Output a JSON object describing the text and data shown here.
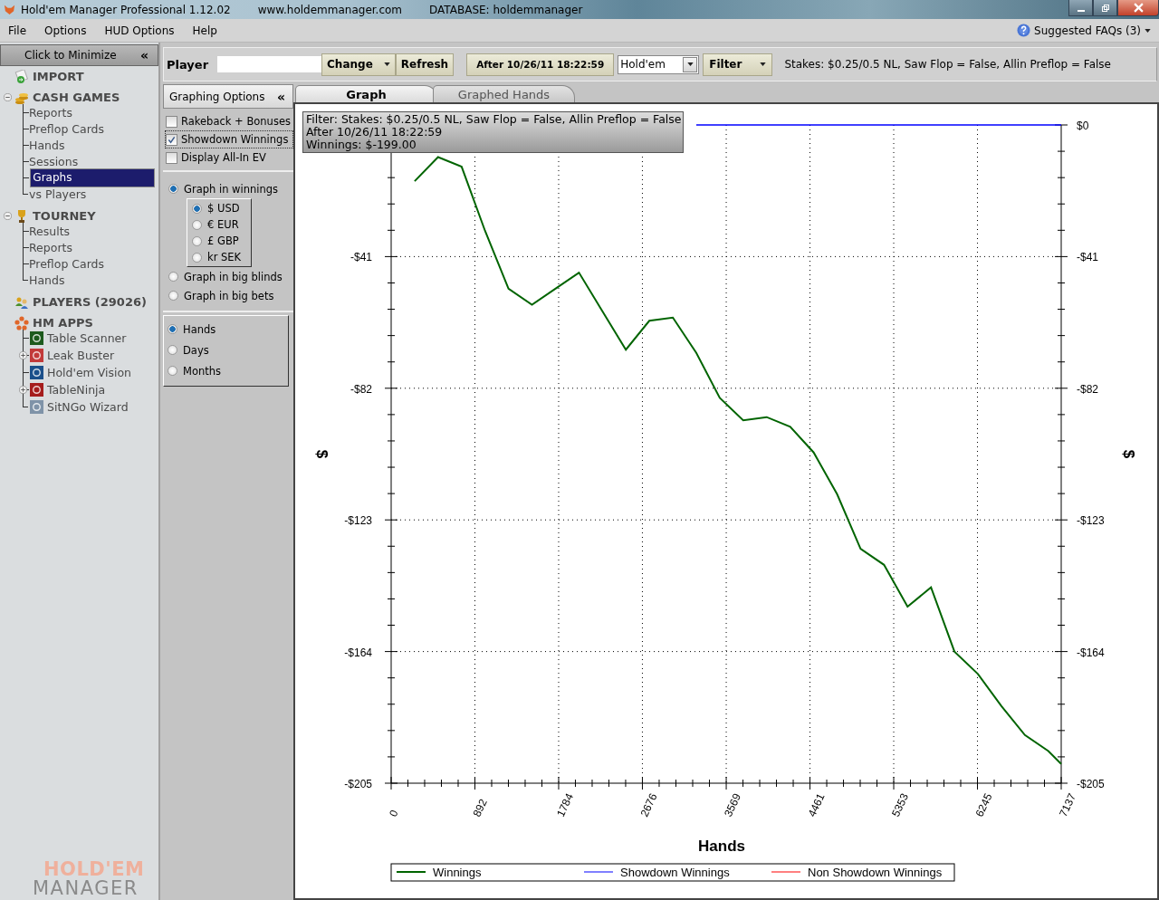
{
  "window": {
    "title": "Hold'em Manager Professional 1.12.02",
    "site": "www.holdemmanager.com",
    "database": "DATABASE: holdemmanager"
  },
  "menu": [
    "File",
    "Options",
    "HUD Options",
    "Help"
  ],
  "faqs": {
    "label": "Suggested FAQs (3)"
  },
  "sidebar": {
    "minimize": {
      "label": "Click to Minimize",
      "glyph": "«"
    },
    "sections": [
      {
        "label": "IMPORT",
        "selected": false
      },
      {
        "label": "CASH GAMES",
        "selected": false,
        "expanded": true,
        "children": [
          {
            "label": "Reports",
            "selected": false
          },
          {
            "label": "Preflop Cards",
            "selected": false
          },
          {
            "label": "Hands",
            "selected": false
          },
          {
            "label": "Sessions",
            "selected": false
          },
          {
            "label": "Graphs",
            "selected": true
          },
          {
            "label": "vs Players",
            "selected": false
          }
        ]
      },
      {
        "label": "TOURNEY",
        "selected": false,
        "expanded": true,
        "children": [
          {
            "label": "Results",
            "selected": false
          },
          {
            "label": "Reports",
            "selected": false
          },
          {
            "label": "Preflop Cards",
            "selected": false
          },
          {
            "label": "Hands",
            "selected": false
          }
        ]
      },
      {
        "label": "PLAYERS (29026)",
        "selected": false
      },
      {
        "label": "HM APPS",
        "selected": false,
        "children": [
          {
            "label": "Table Scanner",
            "selected": false
          },
          {
            "label": "Leak Buster",
            "selected": false,
            "expanded": false
          },
          {
            "label": "Hold'em Vision",
            "selected": false
          },
          {
            "label": "TableNinja",
            "selected": false,
            "expanded": false
          },
          {
            "label": "SitNGo Wizard",
            "selected": false
          }
        ]
      }
    ],
    "logo": [
      "HOLD'EM",
      "MANAGER"
    ]
  },
  "toolbar": {
    "player_label": "Player",
    "change": "Change",
    "refresh": "Refresh",
    "date": "After 10/26/11 18:22:59",
    "game": "Hold'em",
    "filter": "Filter",
    "filter_text": "Stakes: $0.25/0.5 NL, Saw Flop = False, Allin Preflop = False"
  },
  "options": {
    "title": "Graphing Options",
    "glyph": "«",
    "checkboxes": [
      {
        "label": "Rakeback + Bonuses",
        "checked": false
      },
      {
        "label": "Showdown Winnings",
        "checked": true
      },
      {
        "label": "Display All-In EV",
        "checked": false
      }
    ],
    "units": [
      {
        "label": "Graph in winnings",
        "selected": true,
        "currencies": [
          {
            "label": "$ USD",
            "selected": true
          },
          {
            "label": "€ EUR",
            "selected": false
          },
          {
            "label": "£ GBP",
            "selected": false
          },
          {
            "label": "kr SEK",
            "selected": false
          }
        ]
      },
      {
        "label": "Graph in big blinds",
        "selected": false
      },
      {
        "label": "Graph in big bets",
        "selected": false
      }
    ],
    "axis": [
      {
        "label": "Hands",
        "selected": true
      },
      {
        "label": "Days",
        "selected": false
      },
      {
        "label": "Months",
        "selected": false
      }
    ]
  },
  "tabs": [
    {
      "label": "Graph",
      "selected": true
    },
    {
      "label": "Graphed Hands",
      "selected": false
    }
  ],
  "tooltip": [
    "Filter: Stakes: $0.25/0.5 NL, Saw Flop = False, Allin Preflop = False",
    "After 10/26/11 18:22:59",
    "Winnings: $-199.00"
  ],
  "chart_data": {
    "type": "line",
    "xlabel": "Hands",
    "ylabel": "$",
    "x": [
      250,
      500,
      750,
      1000,
      1250,
      1500,
      1750,
      2000,
      2250,
      2500,
      2750,
      3000,
      3250,
      3500,
      3750,
      4000,
      4250,
      4500,
      4750,
      5000,
      5250,
      5500,
      5750,
      6000,
      6250,
      6500,
      6750,
      7000,
      7137
    ],
    "series": [
      {
        "name": "Winnings",
        "color": "#006400",
        "values": [
          -17.5,
          -10,
          -13,
          -33,
          -51,
          -56,
          -51,
          -46,
          -58,
          -70,
          -61,
          -60,
          -71,
          -85,
          -92,
          -91,
          -94,
          -102,
          -115,
          -132,
          -137,
          -150,
          -144,
          -164,
          -171,
          -181,
          -190,
          -195,
          -199
        ]
      },
      {
        "name": "Showdown Winnings",
        "color": "#0000ff",
        "values": [
          null,
          null,
          null,
          null,
          null,
          null,
          null,
          null,
          null,
          null,
          null,
          null,
          0,
          0,
          0,
          0,
          0,
          0,
          0,
          0,
          0,
          0,
          0,
          0,
          0,
          0,
          0,
          0,
          0
        ]
      },
      {
        "name": "Non Showdown Winnings",
        "color": "#ff0000",
        "values": [
          null,
          null,
          null,
          null,
          null,
          null,
          null,
          null,
          null,
          null,
          null,
          null,
          null,
          null,
          null,
          null,
          null,
          null,
          null,
          null,
          null,
          null,
          null,
          null,
          null,
          null,
          null,
          null,
          null
        ]
      }
    ],
    "xlim": [
      0,
      7137
    ],
    "ylim": [
      -205,
      0
    ],
    "grid": true,
    "legend": true,
    "xticks": [
      0,
      892,
      1784,
      2676,
      3569,
      4461,
      5353,
      6245,
      7137
    ],
    "yticks": [
      {
        "value": 0,
        "label": "$0"
      },
      {
        "value": -41,
        "label": "-$41"
      },
      {
        "value": -82,
        "label": "-$82"
      },
      {
        "value": -123,
        "label": "-$123"
      },
      {
        "value": -164,
        "label": "-$164"
      },
      {
        "value": -205,
        "label": "-$205"
      }
    ]
  }
}
